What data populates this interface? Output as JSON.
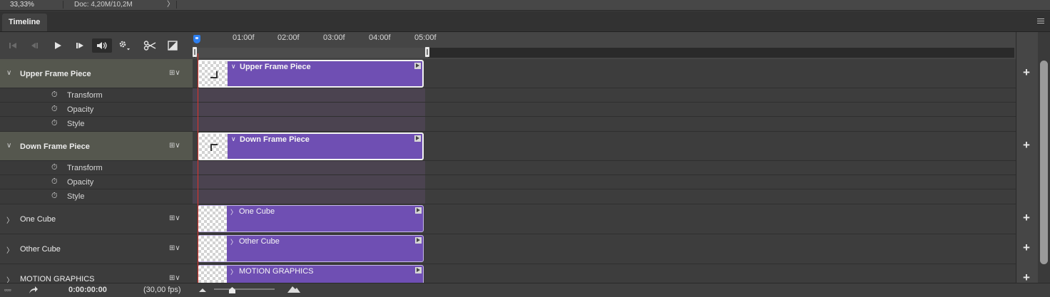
{
  "status_bar": {
    "zoom": "33,33%",
    "doc": "Doc: 4,20M/10,2M",
    "arrow": "〉"
  },
  "panel": {
    "tab_title": "Timeline",
    "collapse_glyph": "◀◀"
  },
  "toolbar": {
    "buttons": [
      "go-to-first-frame",
      "go-to-previous-frame",
      "play",
      "go-to-next-frame",
      "mute-audio",
      "settings",
      "split-at-playhead",
      "transition"
    ]
  },
  "ruler": {
    "ticks": [
      "01:00f",
      "02:00f",
      "03:00f",
      "04:00f",
      "05:00f"
    ]
  },
  "layers": [
    {
      "name": "Upper Frame Piece",
      "expanded": true,
      "selected": true,
      "chevron": "∨",
      "film": "⊞∨",
      "properties": [
        "Transform",
        "Opacity",
        "Style"
      ]
    },
    {
      "name": "Down Frame Piece",
      "expanded": true,
      "selected": true,
      "chevron": "∨",
      "film": "⊞∨",
      "properties": [
        "Transform",
        "Opacity",
        "Style"
      ]
    },
    {
      "name": "One Cube",
      "expanded": false,
      "selected": false,
      "chevron": "〉",
      "film": "⊞∨"
    },
    {
      "name": "Other Cube",
      "expanded": false,
      "selected": false,
      "chevron": "〉",
      "film": "⊞∨"
    },
    {
      "name": "MOTION GRAPHICS",
      "expanded": false,
      "selected": false,
      "chevron": "〉",
      "film": "⊞∨"
    }
  ],
  "property_icon": "⏱",
  "clips": [
    {
      "name": "Upper Frame Piece",
      "chevron": "∨"
    },
    {
      "name": "Down Frame Piece",
      "chevron": "∨"
    },
    {
      "name": "One Cube",
      "chevron": "〉"
    },
    {
      "name": "Other Cube",
      "chevron": "〉"
    },
    {
      "name": "MOTION GRAPHICS",
      "chevron": "〉"
    }
  ],
  "add_track_label": "+",
  "bottom_bar": {
    "timecode": "0:00:00:00",
    "fps": "(30,00 fps)",
    "render_glyph": "▫▫▫"
  },
  "colors": {
    "clip": "#6f4fb3",
    "playhead": "#e0342b",
    "playhead_head": "#2d7ff0",
    "selected_layer": "#55574e"
  }
}
